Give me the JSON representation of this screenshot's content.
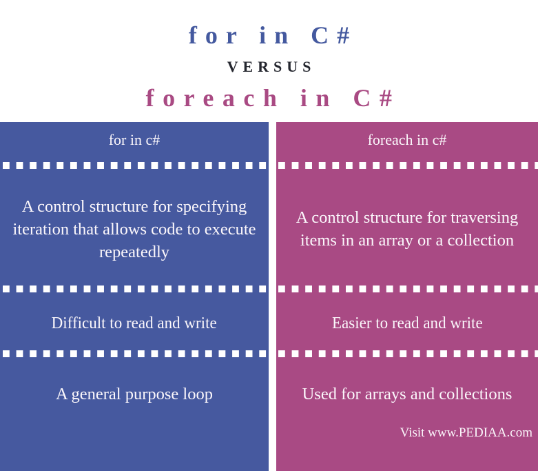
{
  "title": {
    "line1": "for in C#",
    "versus": "VERSUS",
    "line2": "foreach in C#"
  },
  "colors": {
    "left_accent": "#46599f",
    "right_accent": "#a94a84",
    "versus_text": "#24262e",
    "cell_text": "#fbf7fb"
  },
  "columns": [
    {
      "header": "for in c#",
      "rows": [
        "A control structure for specifying iteration that allows code to execute repeatedly",
        "Difficult to read and write",
        "A general purpose loop"
      ]
    },
    {
      "header": "foreach in c#",
      "rows": [
        "A control structure for traversing items in an array or a collection",
        "Easier to read and write",
        "Used for arrays and collections"
      ]
    }
  ],
  "footer": "Visit www.PEDIAA.com"
}
